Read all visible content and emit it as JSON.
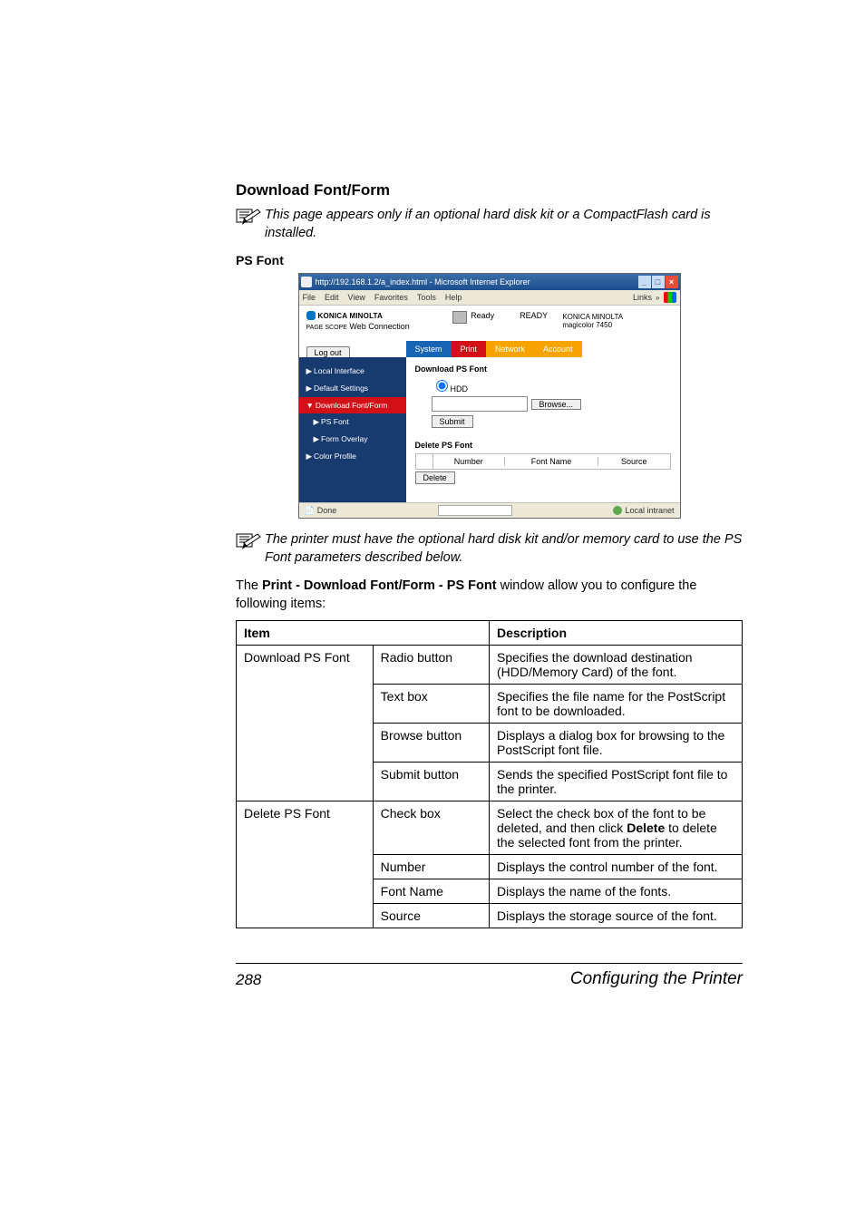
{
  "section_title": "Download Font/Form",
  "note1": "This page appears only if an optional hard disk kit or a CompactFlash card is installed.",
  "sub_heading": "PS Font",
  "screenshot": {
    "title": "http://192.168.1.2/a_index.html - Microsoft Internet Explorer",
    "menu": {
      "file": "File",
      "edit": "Edit",
      "view": "View",
      "favorites": "Favorites",
      "tools": "Tools",
      "help": "Help",
      "links": "Links"
    },
    "brand": "KONICA MINOLTA",
    "webc_prefix": "PAGE SCOPE",
    "webc": "Web Connection",
    "printer_status_label": "Ready",
    "printer_status_big": "READY",
    "right1": "KONICA MINOLTA",
    "right2": "magicolor 7450",
    "logout": "Log out",
    "tabs": {
      "system": "System",
      "print": "Print",
      "network": "Network",
      "account": "Account"
    },
    "side": {
      "local": "Local Interface",
      "default": "Default Settings",
      "download": "Download Font/Form",
      "psfont": "PS Font",
      "formov": "Form Overlay",
      "color": "Color Profile"
    },
    "main": {
      "dl_head": "Download PS Font",
      "radio": "HDD",
      "browse": "Browse...",
      "submit": "Submit",
      "del_head": "Delete PS Font",
      "col_number": "Number",
      "col_fontname": "Font Name",
      "col_source": "Source",
      "delete": "Delete"
    },
    "status_done": "Done",
    "status_zone": "Local intranet"
  },
  "note2": "The printer must have the optional hard disk kit and/or memory card to use the PS Font parameters described below.",
  "intro_before": "The ",
  "intro_bold": "Print - Download Font/Form - PS Font",
  "intro_after": " window allow you to configure the following items:",
  "table": {
    "h_item": "Item",
    "h_desc": "Description",
    "rows": [
      {
        "item": "Download PS Font",
        "ctrl": "Radio button",
        "desc": "Specifies the download destination (HDD/Memory Card) of the font."
      },
      {
        "item": "",
        "ctrl": "Text box",
        "desc": "Specifies the file name for the PostScript font to be downloaded."
      },
      {
        "item": "",
        "ctrl": "Browse button",
        "desc": "Displays a dialog box for browsing to the PostScript font file."
      },
      {
        "item": "",
        "ctrl": "Submit button",
        "desc": "Sends the specified PostScript font file to the printer."
      },
      {
        "item": "Delete PS Font",
        "ctrl": "Check box",
        "desc_pre": "Select the check box of the font to be deleted, and then click ",
        "desc_bold": "Delete",
        "desc_post": " to delete the selected font from the printer."
      },
      {
        "item": "",
        "ctrl": "Number",
        "desc": "Displays the control number of the font."
      },
      {
        "item": "",
        "ctrl": "Font Name",
        "desc": "Displays the name of the fonts."
      },
      {
        "item": "",
        "ctrl": "Source",
        "desc": "Displays the storage source of the font."
      }
    ]
  },
  "footer": {
    "page": "288",
    "title": "Configuring the Printer"
  }
}
